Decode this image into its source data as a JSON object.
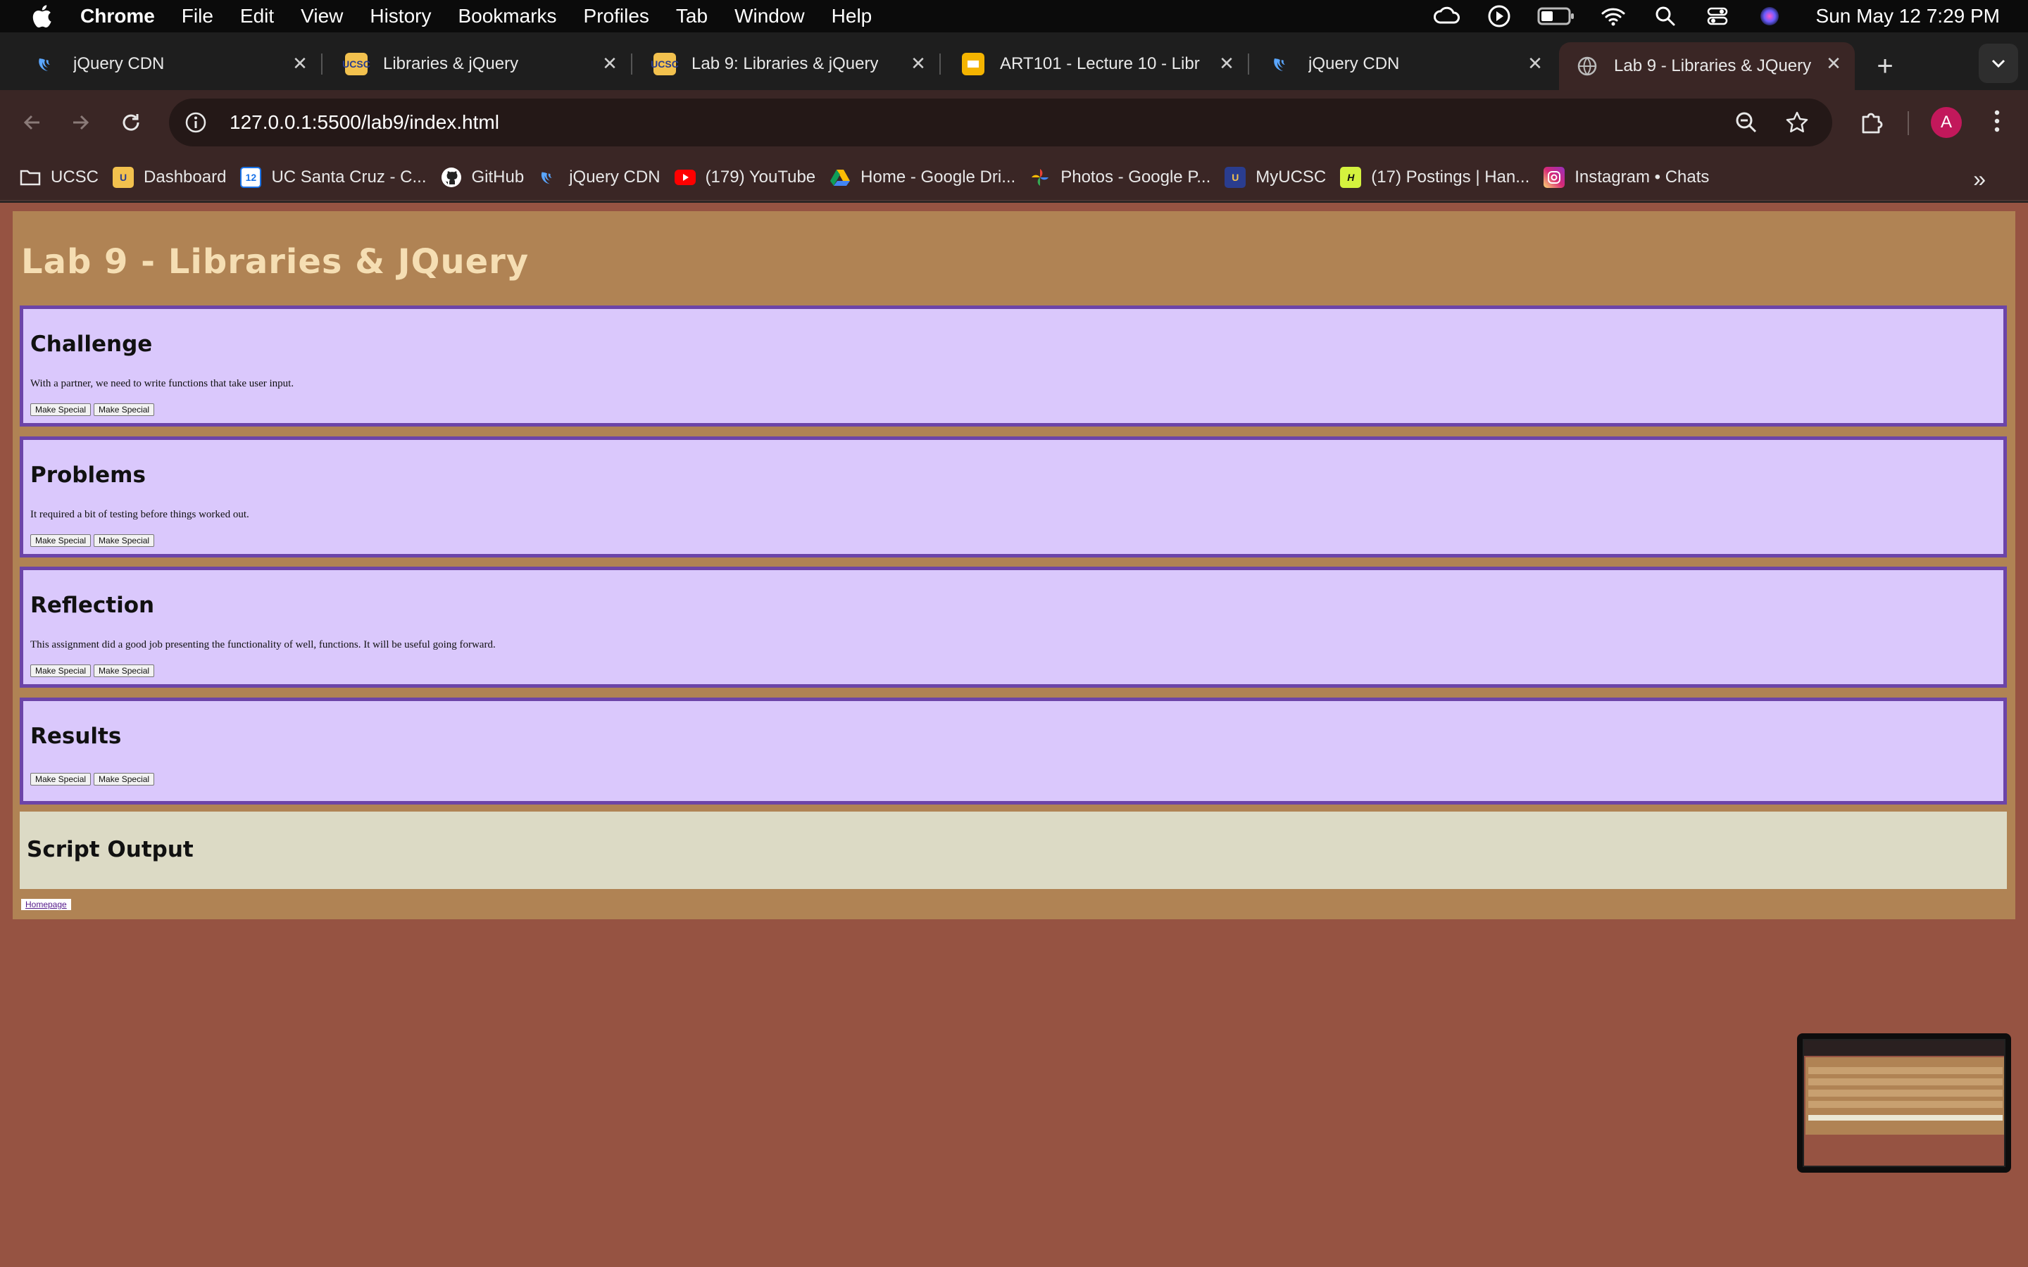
{
  "menubar": {
    "app": "Chrome",
    "items": [
      "File",
      "Edit",
      "View",
      "History",
      "Bookmarks",
      "Profiles",
      "Tab",
      "Window",
      "Help"
    ],
    "clock": "Sun May 12  7:29 PM"
  },
  "tabs": [
    {
      "label": "jQuery CDN",
      "favicon": "jquery-icon"
    },
    {
      "label": "Libraries & jQuery",
      "favicon": "ucsc-icon"
    },
    {
      "label": "Lab 9: Libraries & jQuery",
      "favicon": "ucsc-icon"
    },
    {
      "label": "ART101 - Lecture 10 - Libr",
      "favicon": "slides-icon"
    },
    {
      "label": "jQuery CDN",
      "favicon": "jquery-icon"
    },
    {
      "label": "Lab 9 - Libraries & JQuery",
      "favicon": "globe-icon"
    }
  ],
  "address": {
    "url": "127.0.0.1:5500/lab9/index.html"
  },
  "profile_initial": "A",
  "bookmarks": [
    {
      "label": "UCSC",
      "icon": "folder-icon"
    },
    {
      "label": "Dashboard",
      "icon": "ucsc-icon"
    },
    {
      "label": "UC Santa Cruz - C...",
      "icon": "calendar-icon"
    },
    {
      "label": "GitHub",
      "icon": "github-icon"
    },
    {
      "label": "jQuery CDN",
      "icon": "jquery-icon"
    },
    {
      "label": "(179) YouTube",
      "icon": "youtube-icon"
    },
    {
      "label": "Home - Google Dri...",
      "icon": "drive-icon"
    },
    {
      "label": "Photos - Google P...",
      "icon": "photos-icon"
    },
    {
      "label": "MyUCSC",
      "icon": "ucsc-icon"
    },
    {
      "label": "(17) Postings | Han...",
      "icon": "handshake-icon"
    },
    {
      "label": "Instagram • Chats",
      "icon": "instagram-icon"
    }
  ],
  "page": {
    "title": "Lab 9 - Libraries & JQuery",
    "sections": [
      {
        "heading": "Challenge",
        "text": "With a partner, we need to write functions that take user input.",
        "buttons": [
          "Make Special",
          "Make Special"
        ]
      },
      {
        "heading": "Problems",
        "text": "It required a bit of testing before things worked out.",
        "buttons": [
          "Make Special",
          "Make Special"
        ]
      },
      {
        "heading": "Reflection",
        "text": "This assignment did a good job presenting the functionality of well, functions. It will be useful going forward.",
        "buttons": [
          "Make Special",
          "Make Special"
        ]
      },
      {
        "heading": "Results",
        "text": "",
        "buttons": [
          "Make Special",
          "Make Special"
        ]
      }
    ],
    "output_heading": "Script Output",
    "home_link": "Homepage"
  },
  "colors": {
    "page_bg": "#965342",
    "container_bg": "#b08354",
    "title_color": "#f5deb3",
    "section_bg": "#dac8fc",
    "section_border": "#6c44a8",
    "output_bg": "#dcdac5"
  }
}
